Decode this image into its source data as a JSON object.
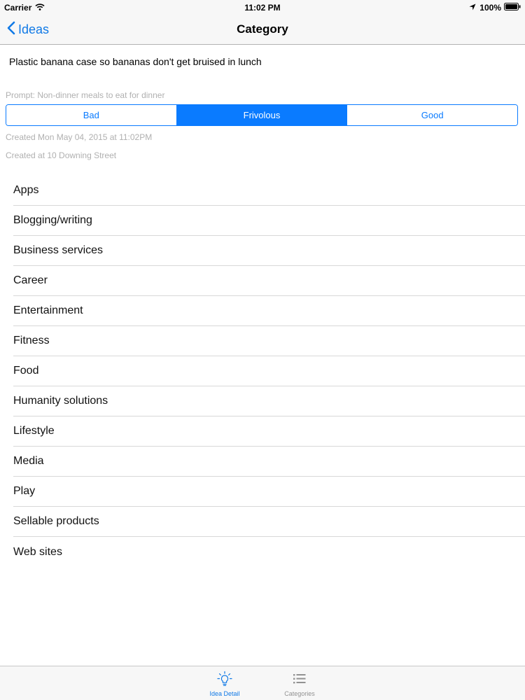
{
  "status_bar": {
    "carrier": "Carrier",
    "time": "11:02 PM",
    "battery": "100%"
  },
  "nav": {
    "back_label": "Ideas",
    "title": "Category"
  },
  "idea": {
    "text": "Plastic banana case so bananas don't get bruised in lunch",
    "prompt": "Prompt: Non-dinner meals to eat for dinner",
    "rating": {
      "options": [
        "Bad",
        "Frivolous",
        "Good"
      ],
      "selected": "Frivolous"
    },
    "created_date": "Created Mon May 04, 2015 at 11:02PM",
    "created_location": "Created at 10 Downing Street"
  },
  "categories": [
    "Apps",
    "Blogging/writing",
    "Business services",
    "Career",
    "Entertainment",
    "Fitness",
    "Food",
    "Humanity solutions",
    "Lifestyle",
    "Media",
    "Play",
    "Sellable products",
    "Web sites"
  ],
  "tab_bar": {
    "tabs": [
      {
        "label": "Idea Detail",
        "icon": "lightbulb-icon",
        "active": true
      },
      {
        "label": "Categories",
        "icon": "list-icon",
        "active": false
      }
    ]
  },
  "colors": {
    "accent": "#0a7bff",
    "tint": "#1079e6",
    "secondary_text": "#b0b0b0"
  }
}
